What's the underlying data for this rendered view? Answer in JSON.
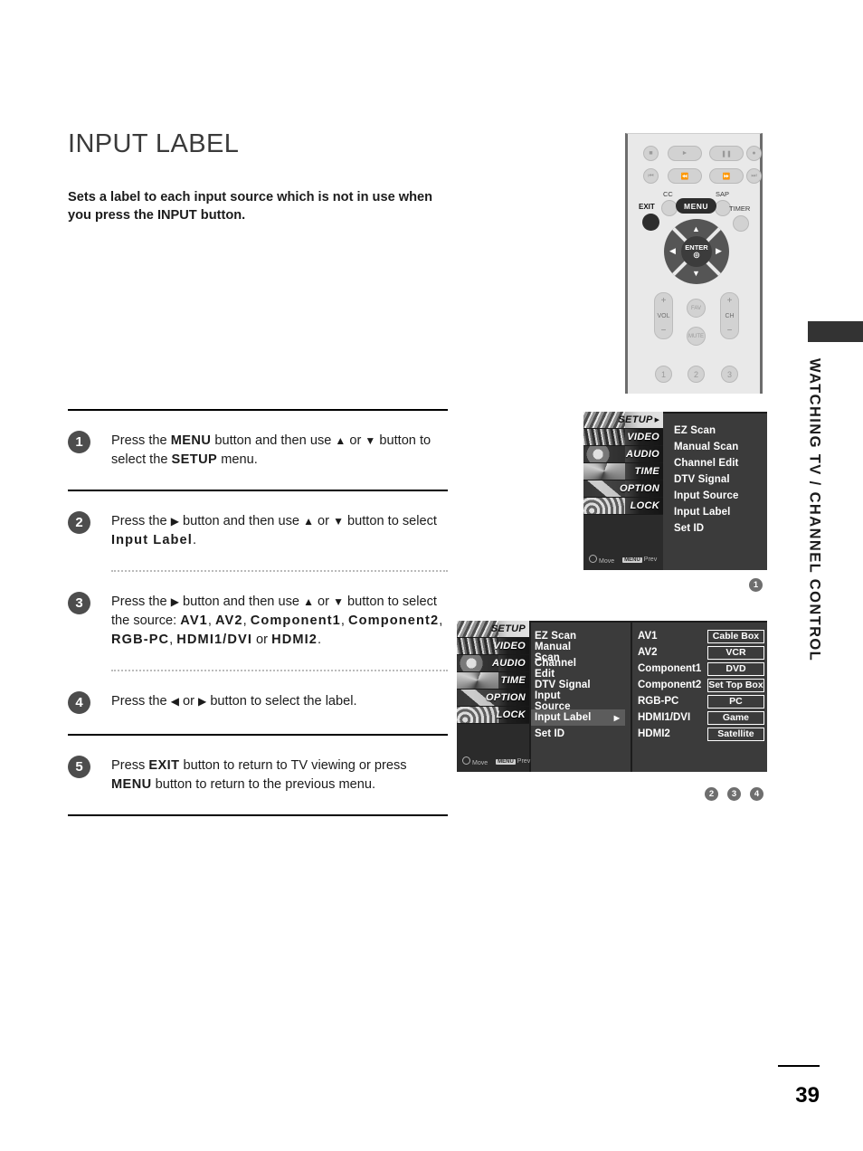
{
  "page": {
    "title": "INPUT LABEL",
    "intro": "Sets a label to each input source which is not in use when you press the INPUT button.",
    "number": "39",
    "rail_label": "WATCHING TV / CHANNEL CONTROL"
  },
  "steps": [
    {
      "num": "1",
      "parts": [
        {
          "t": "Press the ",
          "s": "n"
        },
        {
          "t": "MENU",
          "s": "kb"
        },
        {
          "t": " button and then use ",
          "s": "n"
        },
        {
          "t": "▲",
          "s": "ar"
        },
        {
          "t": " or ",
          "s": "n"
        },
        {
          "t": "▼",
          "s": "ar"
        },
        {
          "t": " button to select the ",
          "s": "n"
        },
        {
          "t": "SETUP",
          "s": "kb"
        },
        {
          "t": " menu.",
          "s": "n"
        }
      ]
    },
    {
      "num": "2",
      "parts": [
        {
          "t": "Press the ",
          "s": "n"
        },
        {
          "t": "▶",
          "s": "ar"
        },
        {
          "t": " button and then use ",
          "s": "n"
        },
        {
          "t": "▲",
          "s": "ar"
        },
        {
          "t": " or ",
          "s": "n"
        },
        {
          "t": "▼",
          "s": "ar"
        },
        {
          "t": " button to select ",
          "s": "n"
        },
        {
          "t": "Input Label",
          "s": "kbw"
        },
        {
          "t": ".",
          "s": "n"
        }
      ]
    },
    {
      "num": "3",
      "parts": [
        {
          "t": "Press the ",
          "s": "n"
        },
        {
          "t": "▶",
          "s": "ar"
        },
        {
          "t": " button and then use ",
          "s": "n"
        },
        {
          "t": "▲",
          "s": "ar"
        },
        {
          "t": " or ",
          "s": "n"
        },
        {
          "t": "▼",
          "s": "ar"
        },
        {
          "t": " button to select the source: ",
          "s": "n"
        },
        {
          "t": "AV1",
          "s": "kbw"
        },
        {
          "t": ", ",
          "s": "n"
        },
        {
          "t": "AV2",
          "s": "kbw"
        },
        {
          "t": ", ",
          "s": "n"
        },
        {
          "t": "Component1",
          "s": "kbw"
        },
        {
          "t": ", ",
          "s": "n"
        },
        {
          "t": "Component2",
          "s": "kbw"
        },
        {
          "t": ", ",
          "s": "n"
        },
        {
          "t": "RGB-PC",
          "s": "kbw"
        },
        {
          "t": ", ",
          "s": "n"
        },
        {
          "t": "HDMI1/DVI",
          "s": "kbw"
        },
        {
          "t": " or ",
          "s": "n"
        },
        {
          "t": "HDMI2",
          "s": "kbw"
        },
        {
          "t": ".",
          "s": "n"
        }
      ]
    },
    {
      "num": "4",
      "parts": [
        {
          "t": "Press the ",
          "s": "n"
        },
        {
          "t": "◀",
          "s": "ar"
        },
        {
          "t": " or ",
          "s": "n"
        },
        {
          "t": "▶",
          "s": "ar"
        },
        {
          "t": " button to select the label.",
          "s": "n"
        }
      ]
    },
    {
      "num": "5",
      "parts": [
        {
          "t": "Press ",
          "s": "n"
        },
        {
          "t": "EXIT",
          "s": "kb"
        },
        {
          "t": " button to return to TV viewing or press ",
          "s": "n"
        },
        {
          "t": "MENU",
          "s": "kb"
        },
        {
          "t": " button to return to the previous menu.",
          "s": "n"
        }
      ]
    }
  ],
  "remote": {
    "transport_row1": [
      "stop-icon",
      "play-icon",
      "pause-icon",
      "record-icon"
    ],
    "transport_row2": [
      "skip-back-icon",
      "rewind-icon",
      "fast-forward-icon",
      "skip-forward-icon"
    ],
    "cc_label": "CC",
    "sap_label": "SAP",
    "timer_label": "TIMER",
    "menu_label": "MENU",
    "exit_label": "EXIT",
    "enter_label": "ENTER",
    "vol_label": "VOL",
    "ch_label": "CH",
    "fav_label": "FAV",
    "mute_label": "MUTE",
    "numbers": [
      "1",
      "2",
      "3"
    ]
  },
  "osd": {
    "categories": [
      "SETUP",
      "VIDEO",
      "AUDIO",
      "TIME",
      "OPTION",
      "LOCK"
    ],
    "selected_category": "SETUP",
    "menu_items": [
      "EZ Scan",
      "Manual Scan",
      "Channel Edit",
      "DTV Signal",
      "Input Source",
      "Input Label",
      "Set ID"
    ],
    "highlighted_item": "Input Label",
    "footer_move": "Move",
    "footer_prev": "Prev",
    "footer_prev_chip": "MENU",
    "sources": [
      {
        "name": "AV1",
        "label": "Cable Box"
      },
      {
        "name": "AV2",
        "label": "VCR"
      },
      {
        "name": "Component1",
        "label": "DVD"
      },
      {
        "name": "Component2",
        "label": "Set Top Box"
      },
      {
        "name": "RGB-PC",
        "label": "PC"
      },
      {
        "name": "HDMI1/DVI",
        "label": "Game"
      },
      {
        "name": "HDMI2",
        "label": "Satellite"
      }
    ]
  },
  "callouts": {
    "first": [
      "1"
    ],
    "second": [
      "2",
      "3",
      "4"
    ]
  },
  "colors": {
    "badge": "#4d4d4d",
    "osd_bg": "#3b3b3b",
    "osd_highlight": "#5c5c5c",
    "rail_tab": "#333333"
  }
}
